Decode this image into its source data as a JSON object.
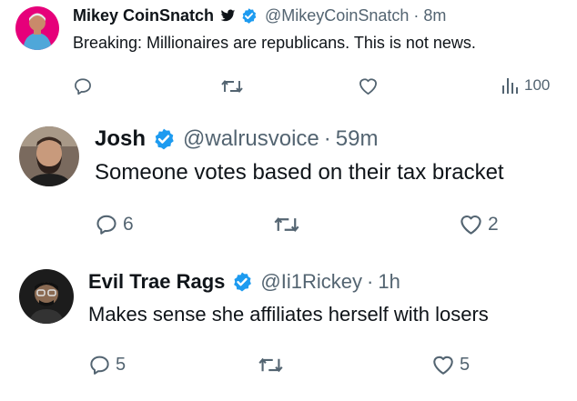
{
  "tweets": [
    {
      "name": "Mikey CoinSnatch",
      "handle": "@MikeyCoinSnatch",
      "separator": "·",
      "time": "8m",
      "text": "Breaking: Millionaires are republicans. This is not news.",
      "views": "100",
      "avatar_icon": "avatar-pink-background"
    },
    {
      "name": "Josh",
      "handle": "@walrusvoice",
      "separator": "·",
      "time": "59m",
      "text": "Someone votes based on their tax bracket",
      "replies": "6",
      "likes": "2"
    },
    {
      "name": "Evil Trae Rags",
      "handle": "@Ii1Rickey",
      "separator": "·",
      "time": "1h",
      "text": "Makes sense she affiliates herself with losers",
      "replies": "5",
      "likes": "5"
    }
  ],
  "colors": {
    "verified": "#1d9bf0",
    "muted": "#536471",
    "text": "#0f1419"
  }
}
